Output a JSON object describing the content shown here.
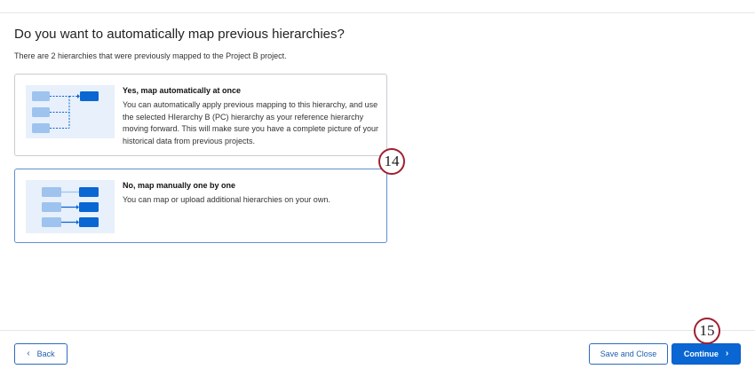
{
  "page": {
    "heading": "Do you want to automatically map previous hierarchies?",
    "subheading": "There are 2 hierarchies that were previously mapped to the Project B project."
  },
  "options": {
    "auto": {
      "title": "Yes, map automatically at once",
      "description": "You can automatically apply previous mapping to this hierarchy, and use the selected HIerarchy B (PC) hierarchy as your reference hierarchy moving forward. This will make sure you have a complete picture of your historical data from previous projects.",
      "illustration": "auto-mapping-diagram"
    },
    "manual": {
      "title": "No, map manually one by one",
      "description": "You can map or upload additional hierarchies on your own.",
      "illustration": "manual-mapping-diagram",
      "selected": true
    }
  },
  "callouts": {
    "first": "14",
    "second": "15"
  },
  "footer": {
    "back_label": "Back",
    "back_icon": "chevron-left-icon",
    "save_label": "Save and Close",
    "continue_label": "Continue",
    "continue_icon": "chevron-right-icon"
  },
  "colors": {
    "primary": "#0a66d2",
    "illustration_bg": "#e8f0fb",
    "node_light": "#9ec3ee",
    "node_dark": "#0a66d2",
    "callout_border": "#a02030",
    "selected_border": "#5f8fd0"
  }
}
